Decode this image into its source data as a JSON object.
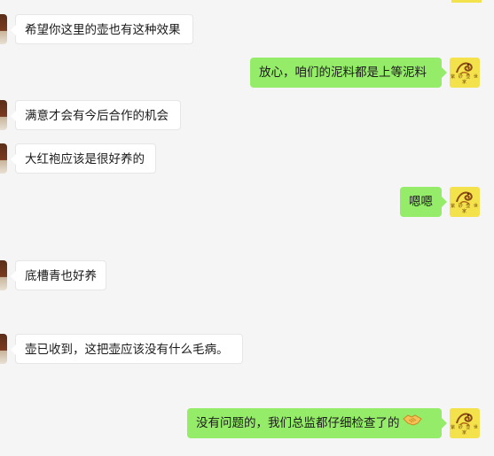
{
  "chat": {
    "messages": [
      {
        "side": "left",
        "text": "希望你这里的壶也有这种效果"
      },
      {
        "side": "right",
        "text": "放心，咱们的泥料都是上等泥料"
      },
      {
        "side": "left",
        "text": "满意才会有今后合作的机会"
      },
      {
        "side": "left",
        "text": "大红袍应该是很好养的"
      },
      {
        "side": "right",
        "text": "嗯嗯"
      },
      {
        "side": "left",
        "text": "底槽青也好养"
      },
      {
        "side": "left",
        "text": "壶已收到，这把壶应该没有什么毛病。"
      },
      {
        "side": "right",
        "text": "没有问题的，我们总监都仔细检查了的",
        "emoji": "handshake-emoji"
      }
    ],
    "self_avatar_text": "紫 砂 壶 世 家"
  },
  "colors": {
    "background": "#f5f5f5",
    "right_bubble": "#95ec69",
    "left_bubble": "#ffffff",
    "self_avatar_bg": "#f3e24b"
  }
}
